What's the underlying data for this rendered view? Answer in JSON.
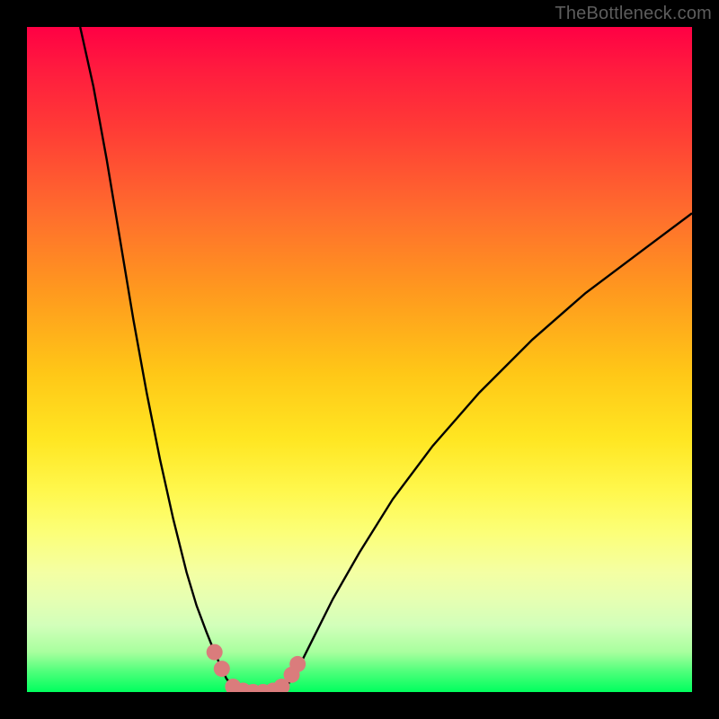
{
  "watermark": "TheBottleneck.com",
  "chart_data": {
    "type": "line",
    "title": "",
    "xlabel": "",
    "ylabel": "",
    "xlim": [
      0,
      100
    ],
    "ylim": [
      0,
      100
    ],
    "grid": false,
    "series": [
      {
        "name": "curve-left",
        "x": [
          8,
          10,
          12,
          14,
          16,
          18,
          20,
          22,
          24,
          25.5,
          27,
          28.2,
          29.3,
          30,
          31,
          32
        ],
        "y": [
          100,
          91,
          80,
          68,
          56,
          45,
          35,
          26,
          18,
          13,
          9,
          6,
          3.5,
          2,
          0.8,
          0
        ]
      },
      {
        "name": "curve-right",
        "x": [
          38,
          39,
          40.5,
          43,
          46,
          50,
          55,
          61,
          68,
          76,
          84,
          92,
          100
        ],
        "y": [
          0,
          0.8,
          3,
          8,
          14,
          21,
          29,
          37,
          45,
          53,
          60,
          66,
          72
        ]
      },
      {
        "name": "floor",
        "x": [
          32,
          33.5,
          35,
          36.5,
          38
        ],
        "y": [
          0,
          0,
          0,
          0,
          0
        ]
      }
    ],
    "markers": [
      {
        "x": 28.2,
        "y": 6.0
      },
      {
        "x": 29.3,
        "y": 3.5
      },
      {
        "x": 31.0,
        "y": 0.8
      },
      {
        "x": 32.5,
        "y": 0.2
      },
      {
        "x": 34.0,
        "y": 0.0
      },
      {
        "x": 35.5,
        "y": 0.0
      },
      {
        "x": 37.0,
        "y": 0.2
      },
      {
        "x": 38.3,
        "y": 0.8
      },
      {
        "x": 39.8,
        "y": 2.6
      },
      {
        "x": 40.7,
        "y": 4.2
      }
    ],
    "colors": {
      "curve": "#000000",
      "marker": "#da7c7c",
      "gradient_top": "#ff0044",
      "gradient_bottom": "#00ff5e"
    }
  }
}
